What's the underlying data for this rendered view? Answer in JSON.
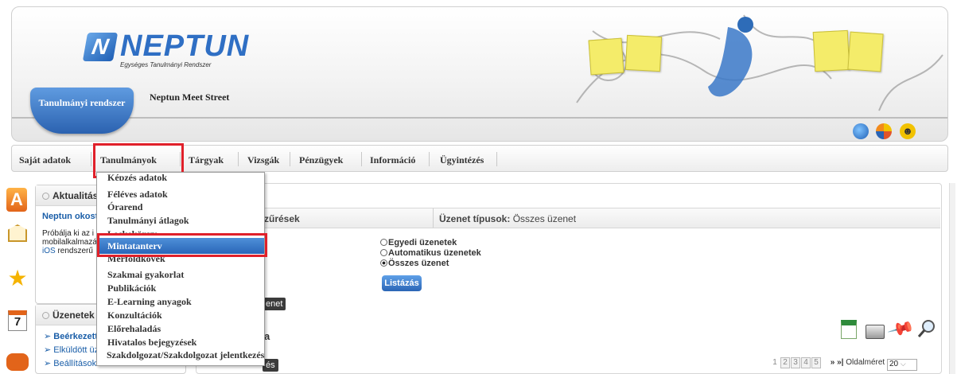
{
  "header": {
    "logo_title": "NEPTUN",
    "logo_subtitle": "Egységes Tanulmányi Rendszer",
    "active_tab": "Tanulmányi rendszer",
    "second_tab": "Neptun Meet Street"
  },
  "menu": {
    "items": [
      "Saját adatok",
      "Tanulmányok",
      "Tárgyak",
      "Vizsgák",
      "Pénzügyek",
      "Információ",
      "Ügyintézés"
    ]
  },
  "dropdown": {
    "items": [
      "Képzés adatok",
      "Féléves adatok",
      "Órarend",
      "Tanulmányi átlagok",
      "Leckekönyv",
      "Mintatanterv",
      "Mérföldkövek",
      "Szakmai gyakorlat",
      "Publikációk",
      "E-Learning anyagok",
      "Konzultációk",
      "Előrehaladás",
      "Hivatalos bejegyzések",
      "Szakdolgozat/Szakdolgozat jelentkezés"
    ],
    "selected": "Mintatanterv"
  },
  "news": {
    "title": "Aktualitáso",
    "headline": "Neptun okost",
    "body": [
      "Próbálja ki az i",
      "mobilalkalmazá",
      "rendszerű"
    ],
    "ios": "iOS"
  },
  "messages": {
    "title": "Üzenetek",
    "links": [
      "Beérkezett",
      "Elküldött üz",
      "Beállítások"
    ]
  },
  "calendar_day": "7",
  "main": {
    "filters_label": "Szűrések",
    "types_label": "Üzenet típusok:",
    "types_value": "Összes üzenet",
    "radio_options": [
      "Egyedi üzenetek",
      "Automatikus üzenetek",
      "Összes üzenet"
    ],
    "radio_selected": 2,
    "list_button": "Listázás",
    "tag_button": "enet",
    "section_letter": "a",
    "bottom_button": "és",
    "pages": [
      "1",
      "2",
      "3",
      "4",
      "5"
    ],
    "page_next": "»",
    "page_last": "»|",
    "page_size_label": "Oldalméret",
    "page_size": "20"
  },
  "icons": {
    "toolbar": [
      "excel-icon",
      "print-icon",
      "pin-icon",
      "search-icon"
    ],
    "header": [
      "globe-icon",
      "color-wheel-icon",
      "smiley-icon"
    ]
  }
}
